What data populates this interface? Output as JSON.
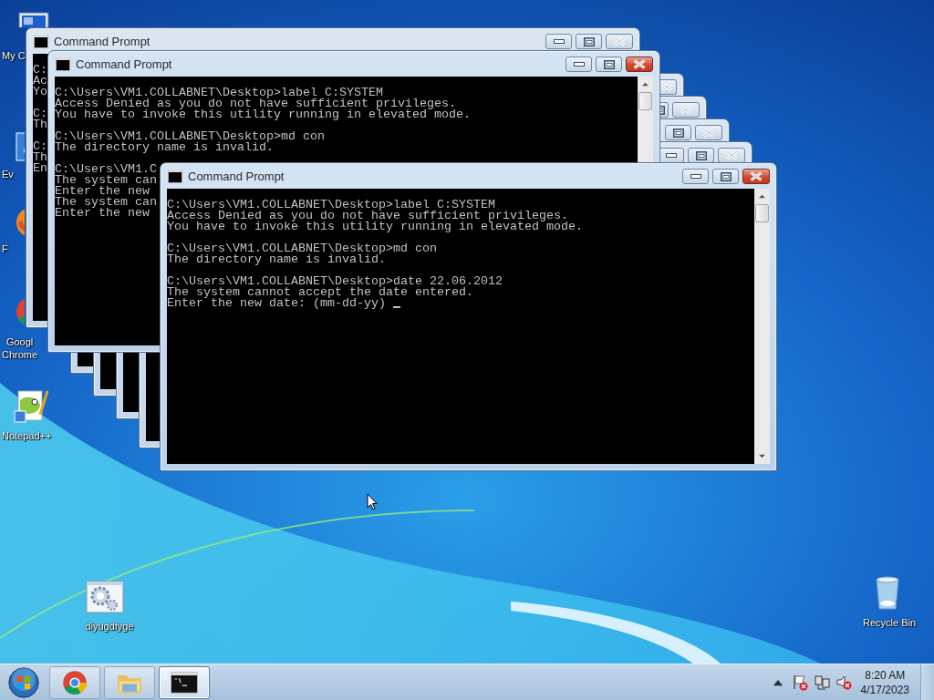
{
  "desktop_icons": [
    {
      "kind": "computer",
      "label": [
        "My C"
      ]
    },
    {
      "kind": "shortcut_blue",
      "label": [
        "Ev"
      ]
    },
    {
      "kind": "firefox",
      "label": [
        "F"
      ]
    },
    {
      "kind": "chrome",
      "label": [
        "Googl",
        "Chrome"
      ]
    },
    {
      "kind": "notepad",
      "label": [
        "Notepad++"
      ]
    },
    {
      "kind": "gear_file",
      "label": [
        "diyugdfyge"
      ]
    },
    {
      "kind": "recycle_bin",
      "label": [
        "Recycle Bin"
      ]
    }
  ],
  "windows": [
    {
      "title": "Command Prompt",
      "active": false,
      "controls": [
        {
          "kind": "minimize"
        },
        {
          "kind": "maximize"
        },
        {
          "kind": "close"
        }
      ],
      "console": [
        [
          "C:",
          "Ac",
          "Yo"
        ],
        [
          "C:",
          "Th"
        ],
        [
          "C:",
          "Th",
          "En"
        ]
      ]
    },
    {
      "title": "Command Prompt",
      "active": true,
      "scrollbar": true,
      "controls": [
        {
          "kind": "minimize"
        },
        {
          "kind": "maximize"
        },
        {
          "kind": "close"
        }
      ],
      "console": [
        [
          "C:\\Users\\VM1.COLLABNET\\Desktop>label C:SYSTEM",
          "Access Denied as you do not have sufficient privileges.",
          "You have to invoke this utility running in elevated mode."
        ],
        [
          "C:\\Users\\VM1.COLLABNET\\Desktop>md con",
          "The directory name is invalid."
        ],
        [
          "C:\\Users\\VM1.C",
          "The system can",
          "Enter the new",
          "The system can",
          "Enter the new"
        ]
      ]
    },
    {
      "active": false,
      "controls": [
        {
          "kind": "close"
        }
      ]
    },
    {
      "active": false,
      "controls": [
        {
          "kind": "maximize"
        },
        {
          "kind": "close"
        }
      ]
    },
    {
      "active": false,
      "controls": [
        {
          "kind": "maximize"
        },
        {
          "kind": "close"
        }
      ]
    },
    {
      "active": false,
      "controls": [
        {
          "kind": "minimize"
        },
        {
          "kind": "maximize"
        },
        {
          "kind": "close"
        }
      ]
    },
    {
      "title": "Command Prompt",
      "active": true,
      "scrollbar": true,
      "cursor": true,
      "controls": [
        {
          "kind": "minimize"
        },
        {
          "kind": "maximize"
        },
        {
          "kind": "close"
        }
      ],
      "console": [
        [
          "C:\\Users\\VM1.COLLABNET\\Desktop>label C:SYSTEM",
          "Access Denied as you do not have sufficient privileges.",
          "You have to invoke this utility running in elevated mode."
        ],
        [
          "C:\\Users\\VM1.COLLABNET\\Desktop>md con",
          "The directory name is invalid."
        ],
        [
          "C:\\Users\\VM1.COLLABNET\\Desktop>date 22.06.2012",
          "The system cannot accept the date entered.",
          "Enter the new date: (mm-dd-yy)"
        ]
      ]
    }
  ],
  "taskbar": {
    "items": [
      {
        "kind": "chrome",
        "selected": false
      },
      {
        "kind": "explorer",
        "selected": false
      },
      {
        "kind": "cmd",
        "selected": true
      }
    ],
    "tray_icons": [
      {
        "kind": "show_hidden"
      },
      {
        "kind": "flag_alert"
      },
      {
        "kind": "network"
      },
      {
        "kind": "volume_muted"
      }
    ],
    "clock": {
      "time": "8:20 AM",
      "date": "4/17/2023"
    }
  }
}
